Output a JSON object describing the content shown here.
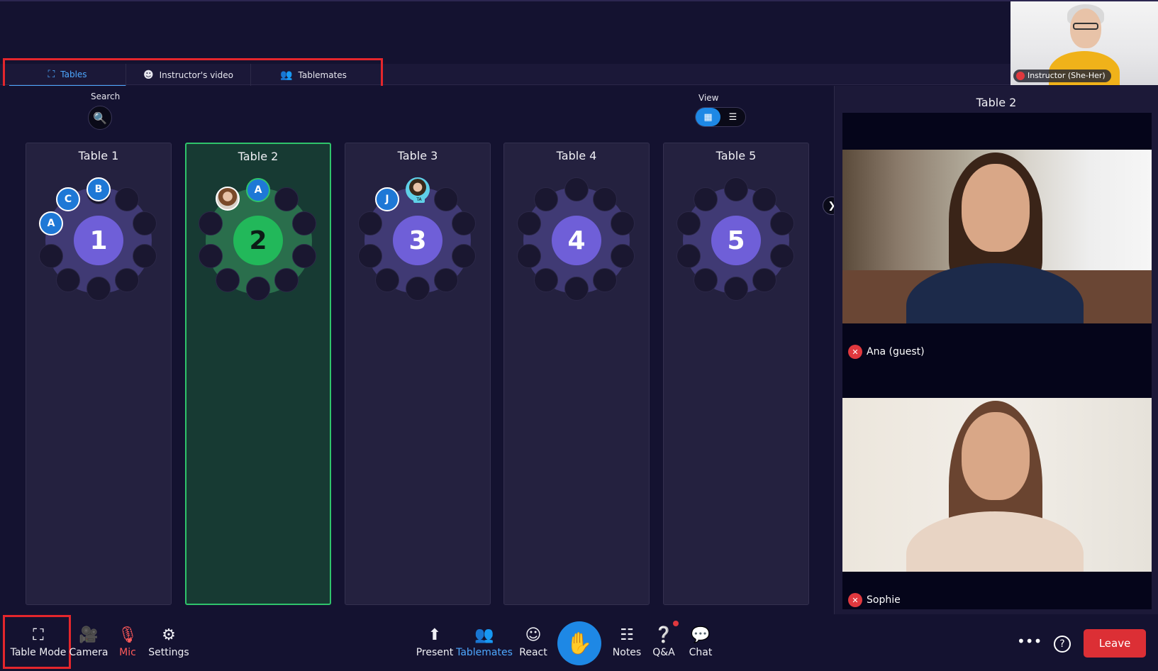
{
  "instructor": {
    "label": "Instructor (She-Her)"
  },
  "tabs": [
    {
      "label": "Tables",
      "icon": "table-mode-icon",
      "active": true
    },
    {
      "label": "Instructor's video",
      "icon": "face-icon",
      "active": false
    },
    {
      "label": "Tablemates",
      "icon": "people-icon",
      "active": false
    }
  ],
  "search": {
    "label": "Search"
  },
  "view": {
    "label": "View"
  },
  "tables": [
    {
      "name": "Table 1",
      "number": "1"
    },
    {
      "name": "Table 2",
      "number": "2"
    },
    {
      "name": "Table 3",
      "number": "3"
    },
    {
      "name": "Table 4",
      "number": "4"
    },
    {
      "name": "Table 5",
      "number": "5"
    }
  ],
  "seat_initials": {
    "t1_a": "A",
    "t1_c": "C",
    "t1_b": "B",
    "t2_a": "A",
    "t3_j": "J",
    "ta_badge": "TA"
  },
  "right_panel": {
    "title": "Table 2",
    "participants": [
      {
        "name": "Ana (guest)",
        "muted": true
      },
      {
        "name": "Sophie",
        "muted": true
      }
    ]
  },
  "toolbar": {
    "table_mode": "Table Mode",
    "camera": "Camera",
    "mic": "Mic",
    "settings": "Settings",
    "present": "Present",
    "tablemates": "Tablemates",
    "react": "React",
    "notes": "Notes",
    "qa": "Q&A",
    "chat": "Chat",
    "leave": "Leave"
  },
  "colors": {
    "background": "#141230",
    "selected_table": "#2fc36b",
    "table_center": "#6f5fd8",
    "accent": "#1e88e5",
    "leave": "#dc2f35",
    "highlight_box": "#e4262c"
  }
}
